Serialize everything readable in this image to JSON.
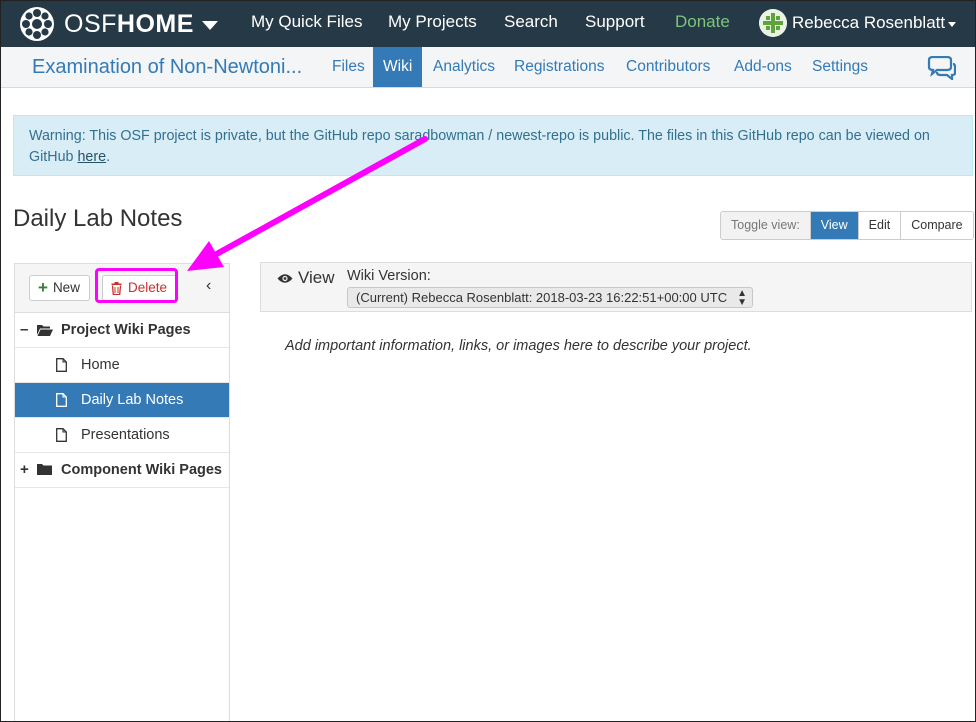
{
  "topnav": {
    "brand_osf": "OSF",
    "brand_home": "HOME",
    "links": [
      "My Quick Files",
      "My Projects",
      "Search",
      "Support",
      "Donate"
    ],
    "user_name": "Rebecca Rosenblatt"
  },
  "project_nav": {
    "title": "Examination of Non-Newtoni...",
    "tabs": [
      "Files",
      "Wiki",
      "Analytics",
      "Registrations",
      "Contributors",
      "Add-ons",
      "Settings"
    ],
    "active_tab": "Wiki"
  },
  "alert": {
    "text": "Warning: This OSF project is private, but the GitHub repo saradbowman / newest-repo is public. The files in this GitHub repo can be viewed on GitHub ",
    "link": "here",
    "end": "."
  },
  "page_title": "Daily Lab Notes",
  "toggle_view": {
    "label": "Toggle view:",
    "buttons": [
      "View",
      "Edit",
      "Compare"
    ],
    "active": "View"
  },
  "sidebar": {
    "new_label": "New",
    "delete_label": "Delete",
    "tree": [
      {
        "label": "Project Wiki Pages",
        "type": "folder",
        "expanded": true,
        "expander": "–"
      },
      {
        "label": "Home",
        "type": "page"
      },
      {
        "label": "Daily Lab Notes",
        "type": "page",
        "active": true
      },
      {
        "label": "Presentations",
        "type": "page"
      },
      {
        "label": "Component Wiki Pages",
        "type": "folder",
        "expanded": false,
        "expander": "+"
      }
    ]
  },
  "view_panel": {
    "title": "View",
    "wiki_version_label": "Wiki Version:",
    "selected_version": "(Current) Rebecca Rosenblatt: 2018-03-23 16:22:51+00:00 UTC",
    "content": "Add important information, links, or images here to describe your project."
  },
  "colors": {
    "topnav_bg": "#263947",
    "accent": "#337ab7",
    "donate": "#7dc57d",
    "alert_bg": "#d9edf7",
    "annotation": "#ff00ff",
    "delete": "#c9302c"
  }
}
